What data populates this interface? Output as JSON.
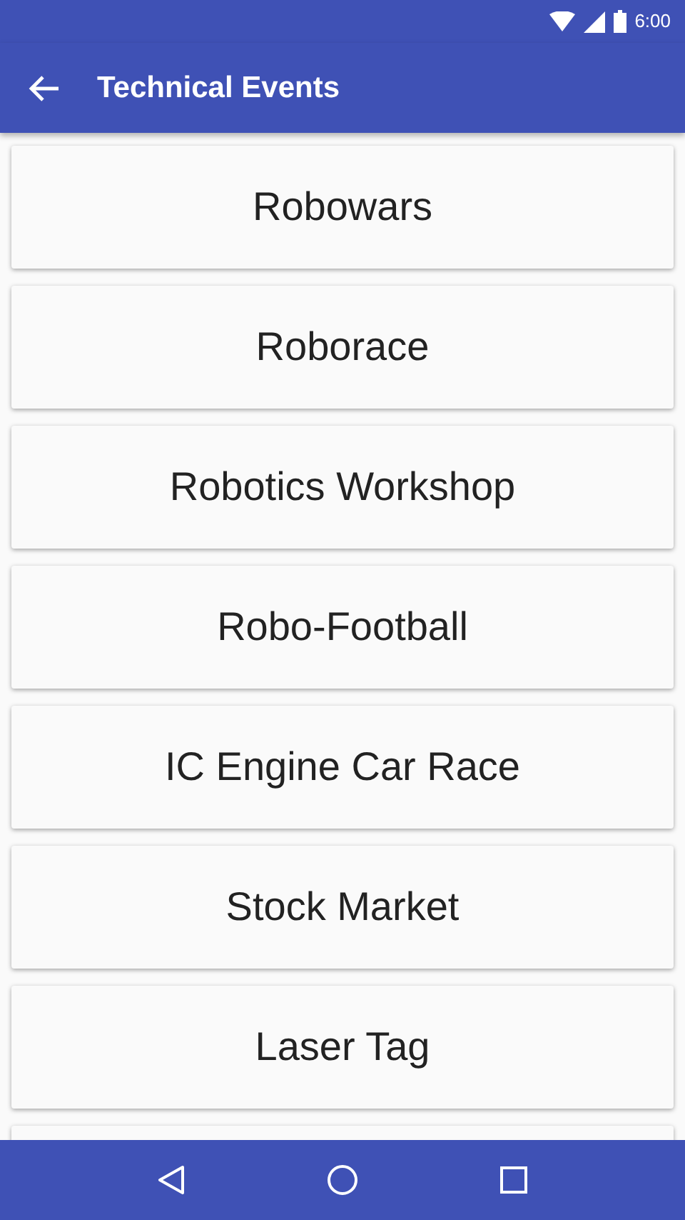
{
  "status_bar": {
    "time": "6:00"
  },
  "app_bar": {
    "title": "Technical Events"
  },
  "events": [
    {
      "label": "Robowars"
    },
    {
      "label": "Roborace"
    },
    {
      "label": "Robotics Workshop"
    },
    {
      "label": "Robo-Football"
    },
    {
      "label": "IC Engine Car Race"
    },
    {
      "label": "Stock Market"
    },
    {
      "label": "Laser Tag"
    }
  ]
}
